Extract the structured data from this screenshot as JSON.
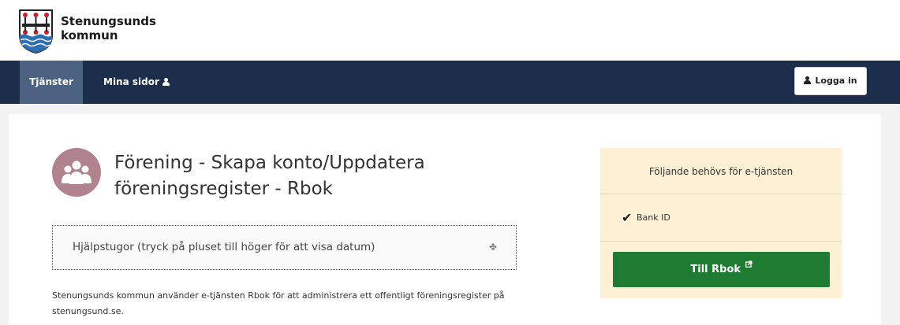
{
  "header": {
    "logo_line1": "Stenungsunds",
    "logo_line2": "kommun"
  },
  "nav": {
    "items": [
      {
        "label": "Tjänster",
        "active": true
      },
      {
        "label": "Mina sidor",
        "icon": "user-icon"
      }
    ],
    "login_label": "Logga in"
  },
  "main": {
    "title": "Förening - Skapa konto/Uppdatera föreningsregister - Rbok",
    "service_icon": "group-icon",
    "help": {
      "label": "Hjälpstugor (tryck på pluset till höger för att visa datum)",
      "icon": "plus-icon"
    },
    "intro": "Stenungsunds kommun använder e-tjänsten Rbok för att administrera ett offentligt föreningsregister på stenungsund.se."
  },
  "sidebar": {
    "heading": "Följande behövs för e-tjänsten",
    "requirements": [
      {
        "label": "Bank ID",
        "icon": "check-icon"
      }
    ],
    "button_label": "Till Rbok",
    "button_icon": "external-link-icon"
  },
  "colors": {
    "navbar": "#1c2e4a",
    "nav_active": "#4b6283",
    "accent_green": "#1f7a32",
    "sidebar_bg": "#fdf0d5",
    "service_icon_bg": "#b0838f"
  }
}
